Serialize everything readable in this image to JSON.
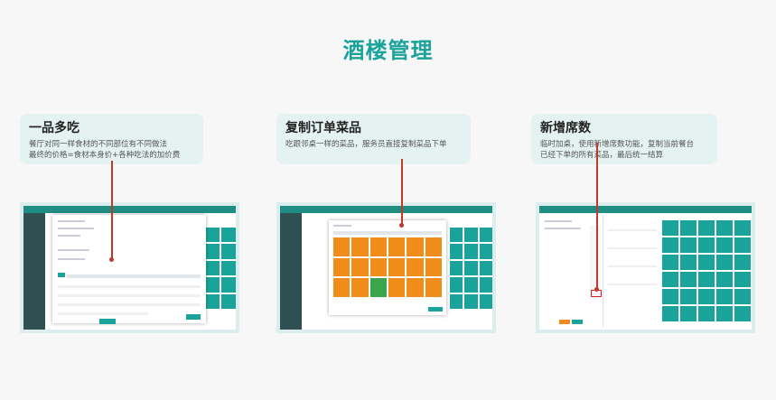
{
  "page": {
    "title": "酒楼管理"
  },
  "features": [
    {
      "title": "一品多吃",
      "lines": [
        "餐厅对同一样食材的不同部位有不同做法",
        "最终的价格=食材本身价+各种吃法的加价费"
      ]
    },
    {
      "title": "复制订单菜品",
      "lines": [
        "吃跟邻桌一样的菜品，服务员直接复制菜品下单"
      ]
    },
    {
      "title": "新增席数",
      "lines": [
        "临时加桌，使用新增席数功能，复制当前餐台",
        "已经下单的所有菜品，最后统一结算"
      ]
    }
  ],
  "colors": {
    "accent": "#1aa39a",
    "card_bg": "#e4f3f1",
    "pointer": "#c0392b",
    "dish_tile": "#f08c1a",
    "selected_tile": "#3aa54a"
  }
}
